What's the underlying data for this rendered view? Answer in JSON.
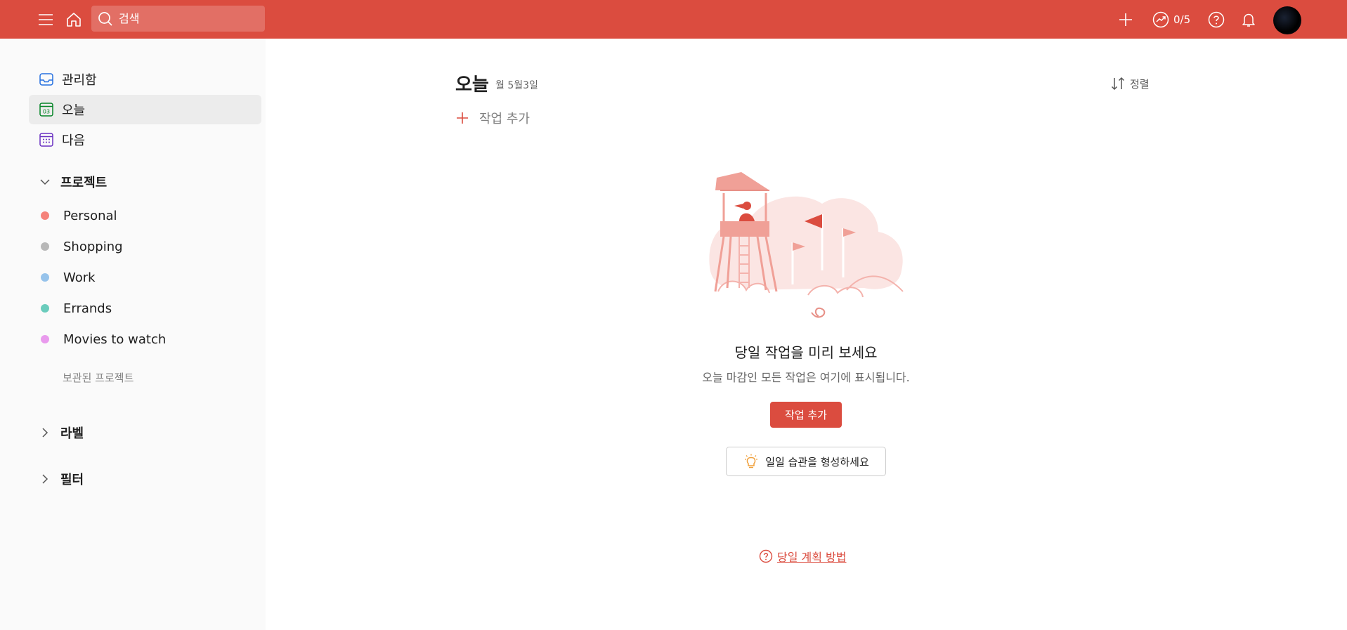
{
  "topbar": {
    "search_placeholder": "검색",
    "karma": "0/5"
  },
  "sidebar": {
    "nav": [
      {
        "label": "관리함",
        "icon": "inbox-icon"
      },
      {
        "label": "오늘",
        "icon": "today-calendar-icon",
        "day": "03"
      },
      {
        "label": "다음",
        "icon": "upcoming-calendar-icon"
      }
    ],
    "projects_header": "프로젝트",
    "projects": [
      {
        "label": "Personal",
        "color": "#f5827a"
      },
      {
        "label": "Shopping",
        "color": "#b8b8b8"
      },
      {
        "label": "Work",
        "color": "#96c3eb"
      },
      {
        "label": "Errands",
        "color": "#6accbc"
      },
      {
        "label": "Movies to watch",
        "color": "#e99aed"
      }
    ],
    "archived": "보관된 프로젝트",
    "labels_header": "라벨",
    "filters_header": "필터"
  },
  "main": {
    "title": "오늘",
    "date": "월 5월3일",
    "sort_label": "정렬",
    "add_task": "작업 추가",
    "empty_title": "당일 작업을 미리 보세요",
    "empty_desc": "오늘 마감인 모든 작업은 여기에 표시됩니다.",
    "add_button": "작업 추가",
    "habit_button": "일일 습관을 형성하세요",
    "help_link": "당일 계획 방법"
  },
  "colors": {
    "brand": "#db4c3f",
    "active_bg": "#ececec",
    "sidebar_bg": "#fafafa"
  }
}
